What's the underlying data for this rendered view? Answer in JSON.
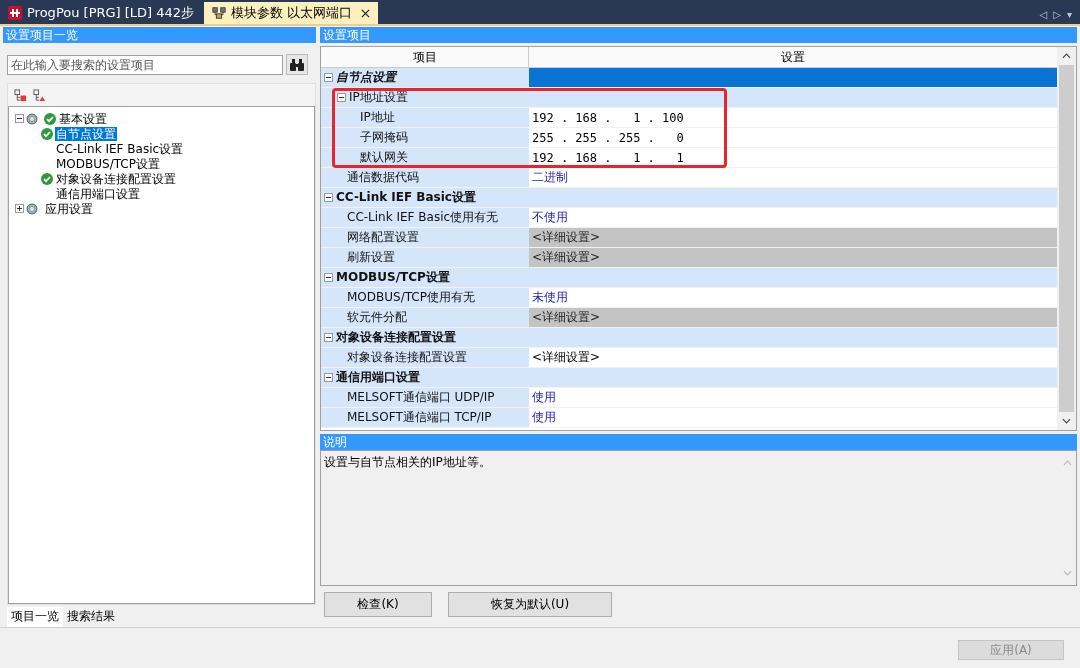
{
  "tabs": [
    {
      "label": "ProgPou [PRG] [LD] 442步",
      "selected": false,
      "closable": false
    },
    {
      "label": "模块参数 以太网端口",
      "selected": true,
      "closable": true
    }
  ],
  "tab_nav": [
    "◁",
    "▷",
    "▾"
  ],
  "left_panel": {
    "title": "设置项目一览",
    "search": {
      "placeholder": "在此输入要搜索的设置项目"
    },
    "tree": [
      {
        "label": "基本设置",
        "configured": true,
        "selected": false,
        "expanded": true,
        "children": [
          {
            "label": "自节点设置",
            "configured": true,
            "selected": true
          },
          {
            "label": "CC-Link IEF Basic设置",
            "configured": false,
            "selected": false
          },
          {
            "label": "MODBUS/TCP设置",
            "configured": false,
            "selected": false
          },
          {
            "label": "对象设备连接配置设置",
            "configured": true,
            "selected": false
          },
          {
            "label": "通信用端口设置",
            "configured": false,
            "selected": false
          }
        ]
      },
      {
        "label": "应用设置",
        "configured": false,
        "selected": false,
        "expanded": false
      }
    ],
    "bottom_tabs": [
      {
        "label": "项目一览",
        "selected": true
      },
      {
        "label": "搜索结果",
        "selected": false
      }
    ]
  },
  "right_panel": {
    "title": "设置项目",
    "columns": [
      "项目",
      "设置"
    ],
    "rows": [
      {
        "label": "自节点设置",
        "selected": true,
        "expanded": true,
        "children": [
          {
            "label": "IP地址设置",
            "selected": false,
            "expanded": true,
            "children": [
              {
                "label": "IP地址",
                "value": "192 . 168 .   1 . 100",
                "kind": "plain",
                "selected": false
              },
              {
                "label": "子网掩码",
                "value": "255 . 255 . 255 .   0",
                "kind": "plain",
                "selected": false
              },
              {
                "label": "默认网关",
                "value": "192 . 168 .   1 .   1",
                "kind": "plain",
                "selected": false
              }
            ]
          },
          {
            "label": "通信数据代码",
            "value": "二进制",
            "kind": "option",
            "selected": false
          }
        ]
      },
      {
        "label": "CC-Link IEF Basic设置",
        "selected": false,
        "expanded": true,
        "children": [
          {
            "label": "CC-Link IEF Basic使用有无",
            "value": "不使用",
            "kind": "option",
            "selected": false
          },
          {
            "label": "网络配置设置",
            "value": "<详细设置>",
            "kind": "detail",
            "disabled": true,
            "selected": false
          },
          {
            "label": "刷新设置",
            "value": "<详细设置>",
            "kind": "detail",
            "disabled": true,
            "selected": false
          }
        ]
      },
      {
        "label": "MODBUS/TCP设置",
        "selected": false,
        "expanded": true,
        "children": [
          {
            "label": "MODBUS/TCP使用有无",
            "value": "未使用",
            "kind": "option",
            "selected": false
          },
          {
            "label": "软元件分配",
            "value": "<详细设置>",
            "kind": "detail",
            "disabled": true,
            "selected": false
          }
        ]
      },
      {
        "label": "对象设备连接配置设置",
        "selected": false,
        "expanded": true,
        "children": [
          {
            "label": "对象设备连接配置设置",
            "value": "<详细设置>",
            "kind": "detail",
            "disabled": false,
            "selected": false
          }
        ]
      },
      {
        "label": "通信用端口设置",
        "selected": false,
        "expanded": true,
        "children": [
          {
            "label": "MELSOFT通信端口 UDP/IP",
            "value": "使用",
            "kind": "option",
            "selected": false
          },
          {
            "label": "MELSOFT通信端口 TCP/IP",
            "value": "使用",
            "kind": "option",
            "selected": false
          }
        ]
      }
    ]
  },
  "description": {
    "title": "说明",
    "text": "设置与自节点相关的IP地址等。"
  },
  "buttons": [
    {
      "label": "检查(K)"
    },
    {
      "label": "恢复为默认(U)"
    }
  ],
  "apply_button": {
    "label": "应用(A)",
    "disabled": true
  }
}
